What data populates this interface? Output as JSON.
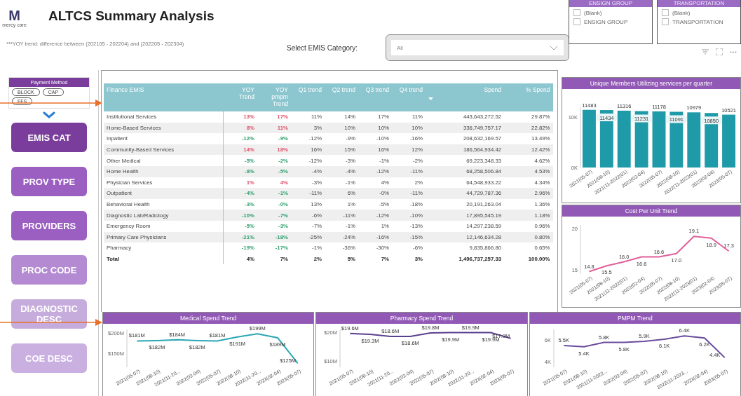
{
  "header": {
    "logo_text": "mercy care",
    "logo_letter": "M",
    "title": "ALTCS Summary Analysis",
    "note": "***YOY trend: difference between (202105 - 202204) and (202205 - 202304)",
    "category_label": "Select EMIS Category:",
    "category_value": "All"
  },
  "slicers": [
    {
      "title": "ENSIGN GROUP",
      "options": [
        {
          "label": "(Blank)",
          "checked": false
        },
        {
          "label": "ENSIGN GROUP",
          "checked": false
        }
      ]
    },
    {
      "title": "TRANSPORTATION",
      "options": [
        {
          "label": "(Blank)",
          "checked": false
        },
        {
          "label": "TRANSPORTATION",
          "checked": false
        }
      ]
    }
  ],
  "sidebar": {
    "payment_method": {
      "title": "Payment Method",
      "options": [
        {
          "label": "BLOCK",
          "selected": false
        },
        {
          "label": "CAP",
          "selected": false
        },
        {
          "label": "FFS",
          "selected": false
        }
      ]
    },
    "buttons": [
      {
        "label": "EMIS CAT",
        "color": "#7a3d9c"
      },
      {
        "label": "PROV TYPE",
        "color": "#9b5fc2"
      },
      {
        "label": "PROVIDERS",
        "color": "#9b5fc2"
      },
      {
        "label": "PROC CODE",
        "color": "#b48bd2"
      },
      {
        "label": "DIAGNOSTIC DESC",
        "color": "#c6acdc"
      },
      {
        "label": "COE DESC",
        "color": "#c9b0e0"
      }
    ]
  },
  "table": {
    "columns": [
      "Finance EMIS",
      "YOY Trend",
      "YOY pmpm Trend",
      "Q1 trend",
      "Q2 trend",
      "Q3 trend",
      "Q4 trend",
      "Spend",
      "% Spend"
    ],
    "rows": [
      {
        "name": "Institutional Services",
        "yoy": {
          "text": "13%",
          "up": true
        },
        "yoy_pmpm": {
          "text": "17%",
          "up": true
        },
        "q": [
          "11%",
          "14%",
          "17%",
          "11%"
        ],
        "spend": "443,643,272.52",
        "share": "29.87%"
      },
      {
        "name": "Home-Based Services",
        "yoy": {
          "text": "8%",
          "up": true
        },
        "yoy_pmpm": {
          "text": "11%",
          "up": true
        },
        "q": [
          "3%",
          "10%",
          "10%",
          "10%"
        ],
        "spend": "336,749,757.17",
        "share": "22.82%"
      },
      {
        "name": "Inpatient",
        "yoy": {
          "text": "-12%",
          "up": false
        },
        "yoy_pmpm": {
          "text": "-9%",
          "up": false
        },
        "q": [
          "-12%",
          "-9%",
          "-10%",
          "-16%"
        ],
        "spend": "208,632,169.57",
        "share": "13.49%"
      },
      {
        "name": "Community-Based Services",
        "yoy": {
          "text": "14%",
          "up": true
        },
        "yoy_pmpm": {
          "text": "18%",
          "up": true
        },
        "q": [
          "16%",
          "15%",
          "16%",
          "12%"
        ],
        "spend": "186,564,934.42",
        "share": "12.42%"
      },
      {
        "name": "Other Medical",
        "yoy": {
          "text": "-5%",
          "up": false
        },
        "yoy_pmpm": {
          "text": "-2%",
          "up": false
        },
        "q": [
          "-12%",
          "-3%",
          "-1%",
          "-2%"
        ],
        "spend": "69,223,348.33",
        "share": "4.62%"
      },
      {
        "name": "Home Health",
        "yoy": {
          "text": "-8%",
          "up": false
        },
        "yoy_pmpm": {
          "text": "-5%",
          "up": false
        },
        "q": [
          "-4%",
          "-4%",
          "-12%",
          "-11%"
        ],
        "spend": "68,258,506.84",
        "share": "4.53%"
      },
      {
        "name": "Physician Services",
        "yoy": {
          "text": "1%",
          "up": true
        },
        "yoy_pmpm": {
          "text": "4%",
          "up": true
        },
        "q": [
          "-3%",
          "-1%",
          "4%",
          "2%"
        ],
        "spend": "64,548,933.22",
        "share": "4.34%"
      },
      {
        "name": "Outpatient",
        "yoy": {
          "text": "-4%",
          "up": false
        },
        "yoy_pmpm": {
          "text": "-1%",
          "up": false
        },
        "q": [
          "-11%",
          "6%",
          "-0%",
          "-11%"
        ],
        "spend": "44,729,787.36",
        "share": "2.96%"
      },
      {
        "name": "Behavioral Health",
        "yoy": {
          "text": "-3%",
          "up": false
        },
        "yoy_pmpm": {
          "text": "-0%",
          "up": false
        },
        "q": [
          "13%",
          "1%",
          "-5%",
          "-18%"
        ],
        "spend": "20,191,263.04",
        "share": "1.36%"
      },
      {
        "name": "Diagnostic Lab/Radiology",
        "yoy": {
          "text": "-10%",
          "up": false
        },
        "yoy_pmpm": {
          "text": "-7%",
          "up": false
        },
        "q": [
          "-6%",
          "-11%",
          "-12%",
          "-10%"
        ],
        "spend": "17,895,545.19",
        "share": "1.18%"
      },
      {
        "name": "Emergency Room",
        "yoy": {
          "text": "-5%",
          "up": false
        },
        "yoy_pmpm": {
          "text": "-3%",
          "up": false
        },
        "q": [
          "-7%",
          "-1%",
          "1%",
          "-13%"
        ],
        "spend": "14,297,238.59",
        "share": "0.96%"
      },
      {
        "name": "Primary Care Physicians",
        "yoy": {
          "text": "-21%",
          "up": false
        },
        "yoy_pmpm": {
          "text": "-18%",
          "up": false
        },
        "q": [
          "-25%",
          "-24%",
          "-16%",
          "-15%"
        ],
        "spend": "12,146,634.28",
        "share": "0.80%"
      },
      {
        "name": "Pharmacy",
        "yoy": {
          "text": "-19%",
          "up": false
        },
        "yoy_pmpm": {
          "text": "-17%",
          "up": false
        },
        "q": [
          "-1%",
          "-36%",
          "-30%",
          "-6%"
        ],
        "spend": "9,835,866.80",
        "share": "0.65%"
      }
    ],
    "total": {
      "name": "Total",
      "yoy": "4%",
      "yoy_pmpm": "7%",
      "q": [
        "2%",
        "5%",
        "7%",
        "3%"
      ],
      "spend": "1,496,737,257.33",
      "share": "100.00%"
    }
  },
  "right_charts": [
    {
      "title": "Unique Members Utilizing services per quarter",
      "chart_data": {
        "type": "bar",
        "categories": [
          "2021(05-07)",
          "2021(08-10)",
          "2021(11-2022(01)",
          "2022(02-04)",
          "2022(05-07)",
          "2022(08-10)",
          "2022(11-2023(01)",
          "2023(02-04)",
          "2023(05-07)"
        ],
        "series": [
          {
            "color": "#1f9aa8",
            "values": [
              11483,
              11434,
              11316,
              11231,
              11178,
              11091,
              10979,
              10850,
              10521
            ]
          }
        ],
        "ylim": [
          0,
          12000
        ],
        "yticks": [
          {
            "value": 0,
            "label": "0K"
          },
          {
            "value": 10000,
            "label": "10K"
          }
        ],
        "data_labels": true
      }
    },
    {
      "title": "Cost Per Unit Trend",
      "chart_data": {
        "type": "line",
        "categories": [
          "2021(05-07)",
          "2021(08-10)",
          "2021(11-2022(01)",
          "2022(02-04)",
          "2022(05-07)",
          "2022(08-10)",
          "2022(11-2023(01)",
          "2023(02-04)",
          "2023(05-07)"
        ],
        "series": [
          {
            "color": "#e0609a",
            "values": [
              14.8,
              15.5,
              16.0,
              16.6,
              16.6,
              17.0,
              19.1,
              18.9,
              17.3
            ]
          }
        ],
        "ylim": [
          14.5,
          20.5
        ],
        "yticks": [
          15,
          20
        ],
        "value_labels": [
          "14.8",
          "15.5",
          "16.0",
          "16.6",
          "16.6",
          "17.0",
          "19.1",
          "18.9",
          "17.3"
        ]
      }
    }
  ],
  "bottom_charts": [
    {
      "title": "Medical Spend Trend",
      "chart_data": {
        "type": "line",
        "categories": [
          "2021(05-07)",
          "2021(08-10)",
          "2021(11-20...",
          "2022(02-04)",
          "2022(05-07)",
          "2022(08-10)",
          "2022(11-20...",
          "2023(02-04)",
          "2023(05-07)"
        ],
        "series": [
          {
            "color": "#2aa7b5",
            "values": [
              181,
              182,
              184,
              182,
              181,
              191,
              199,
              189,
              125
            ]
          }
        ],
        "ylim": [
          115,
          210
        ],
        "yticks": [
          {
            "value": 150,
            "label": "$150M"
          },
          {
            "value": 200,
            "label": "$200M"
          }
        ],
        "value_labels": [
          "$181M",
          "$182M",
          "$184M",
          "$182M",
          "$181M",
          "$191M",
          "$199M",
          "$189M",
          "$125M"
        ]
      }
    },
    {
      "title": "Pharmacy Spend Trend",
      "chart_data": {
        "type": "line",
        "categories": [
          "2021(05-07)",
          "2021(08-10)",
          "2021(11-20...",
          "2022(02-04)",
          "2022(05-07)",
          "2022(08-10)",
          "2022(11-20...",
          "2023(02-04)",
          "2023(05-07)"
        ],
        "series": [
          {
            "color": "#5a3f8e",
            "values": [
              19.6,
              19.3,
              18.6,
              18.6,
              19.8,
              19.9,
              19.9,
              19.9,
              17.9
            ]
          }
        ],
        "ylim": [
          8,
          21
        ],
        "yticks": [
          {
            "value": 10,
            "label": "$10M"
          },
          {
            "value": 20,
            "label": "$20M"
          }
        ],
        "value_labels": [
          "$19.6M",
          "$19.3M",
          "$18.6M",
          "$18.6M",
          "$19.8M",
          "$19.9M",
          "$19.9M",
          "$19.9M",
          "$17.9M"
        ]
      }
    },
    {
      "title": "PMPM Trend",
      "chart_data": {
        "type": "line",
        "categories": [
          "2021(05-07)",
          "2021(08-10)",
          "2021(11-2022...",
          "2022(02-04)",
          "2022(05-07)",
          "2022(08-10)",
          "2022(11-2023...",
          "2023(02-04)",
          "2023(05-07)"
        ],
        "series": [
          {
            "color": "#6a4c9c",
            "values": [
              5.5,
              5.4,
              5.8,
              5.8,
              5.9,
              6.1,
              6.4,
              6.2,
              4.4
            ]
          }
        ],
        "ylim": [
          3.5,
          7
        ],
        "yticks": [
          {
            "value": 4,
            "label": "4K"
          },
          {
            "value": 6,
            "label": "6K"
          }
        ],
        "value_labels": [
          "5.5K",
          "5.4K",
          "5.8K",
          "5.8K",
          "5.9K",
          "6.1K",
          "6.4K",
          "6.2K",
          "4.4K"
        ]
      }
    }
  ]
}
